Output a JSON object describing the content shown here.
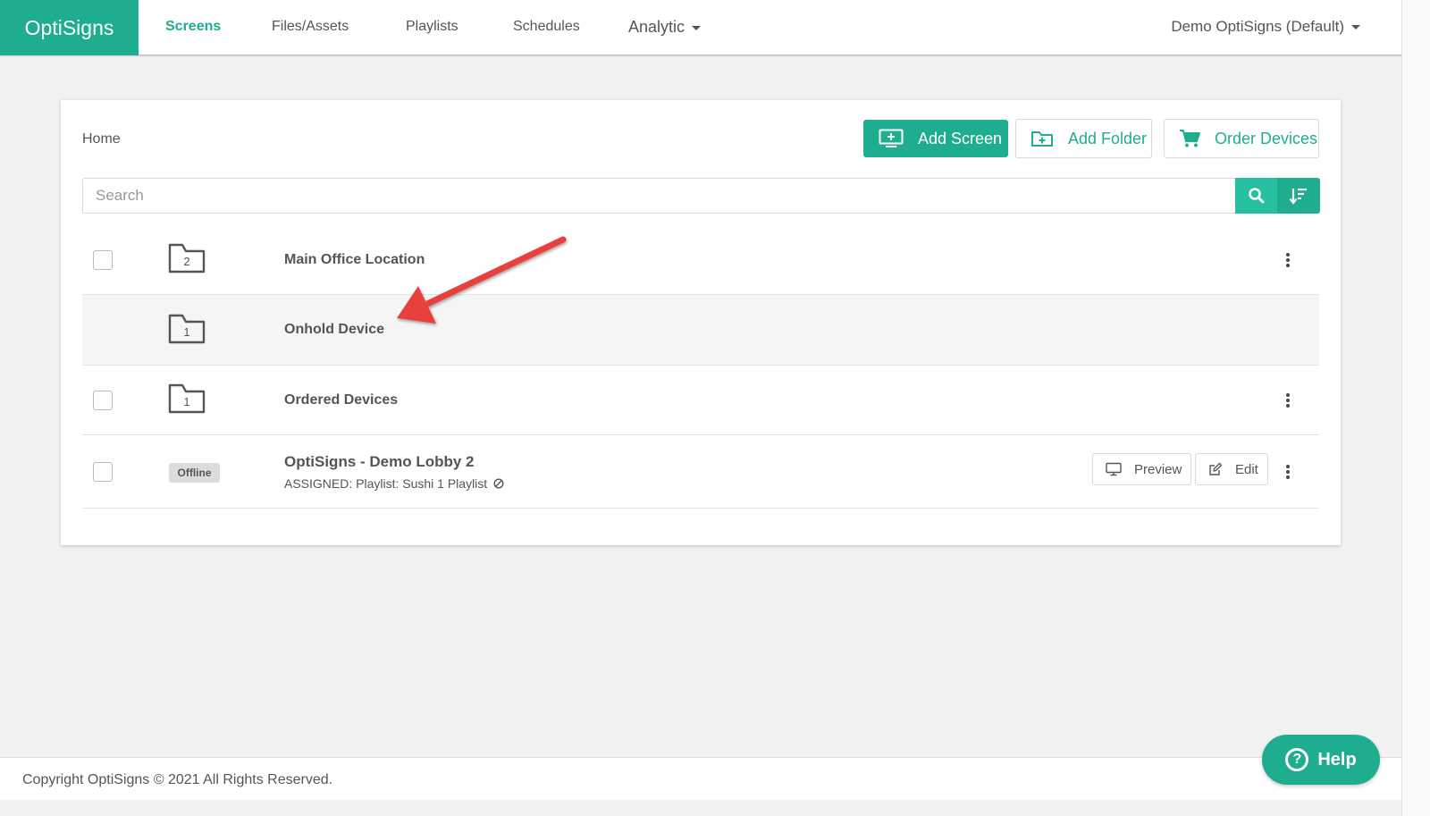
{
  "nav": {
    "brand": "OptiSigns",
    "items": [
      {
        "label": "Screens"
      },
      {
        "label": "Files/Assets"
      },
      {
        "label": "Playlists"
      },
      {
        "label": "Schedules"
      },
      {
        "label": "Analytic"
      }
    ],
    "account": "Demo OptiSigns (Default)"
  },
  "page": {
    "breadcrumb": "Home",
    "buttons": {
      "add_screen": "Add Screen",
      "add_folder": "Add Folder",
      "order_devices": "Order Devices"
    },
    "search": {
      "placeholder": "Search"
    },
    "folders": [
      {
        "name": "Main Office Location",
        "count": "2"
      },
      {
        "name": "Onhold Device",
        "count": "1"
      },
      {
        "name": "Ordered Devices",
        "count": "1"
      }
    ],
    "screen": {
      "status": "Offline",
      "name": "OptiSigns - Demo Lobby 2",
      "assigned": "ASSIGNED: Playlist: Sushi 1 Playlist",
      "preview_label": "Preview",
      "edit_label": "Edit"
    }
  },
  "footer": {
    "copyright": "Copyright OptiSigns © 2021 All Rights Reserved."
  },
  "help": {
    "label": "Help"
  },
  "colors": {
    "brand": "#1fad8f",
    "annotation_arrow": "#e8413c"
  }
}
